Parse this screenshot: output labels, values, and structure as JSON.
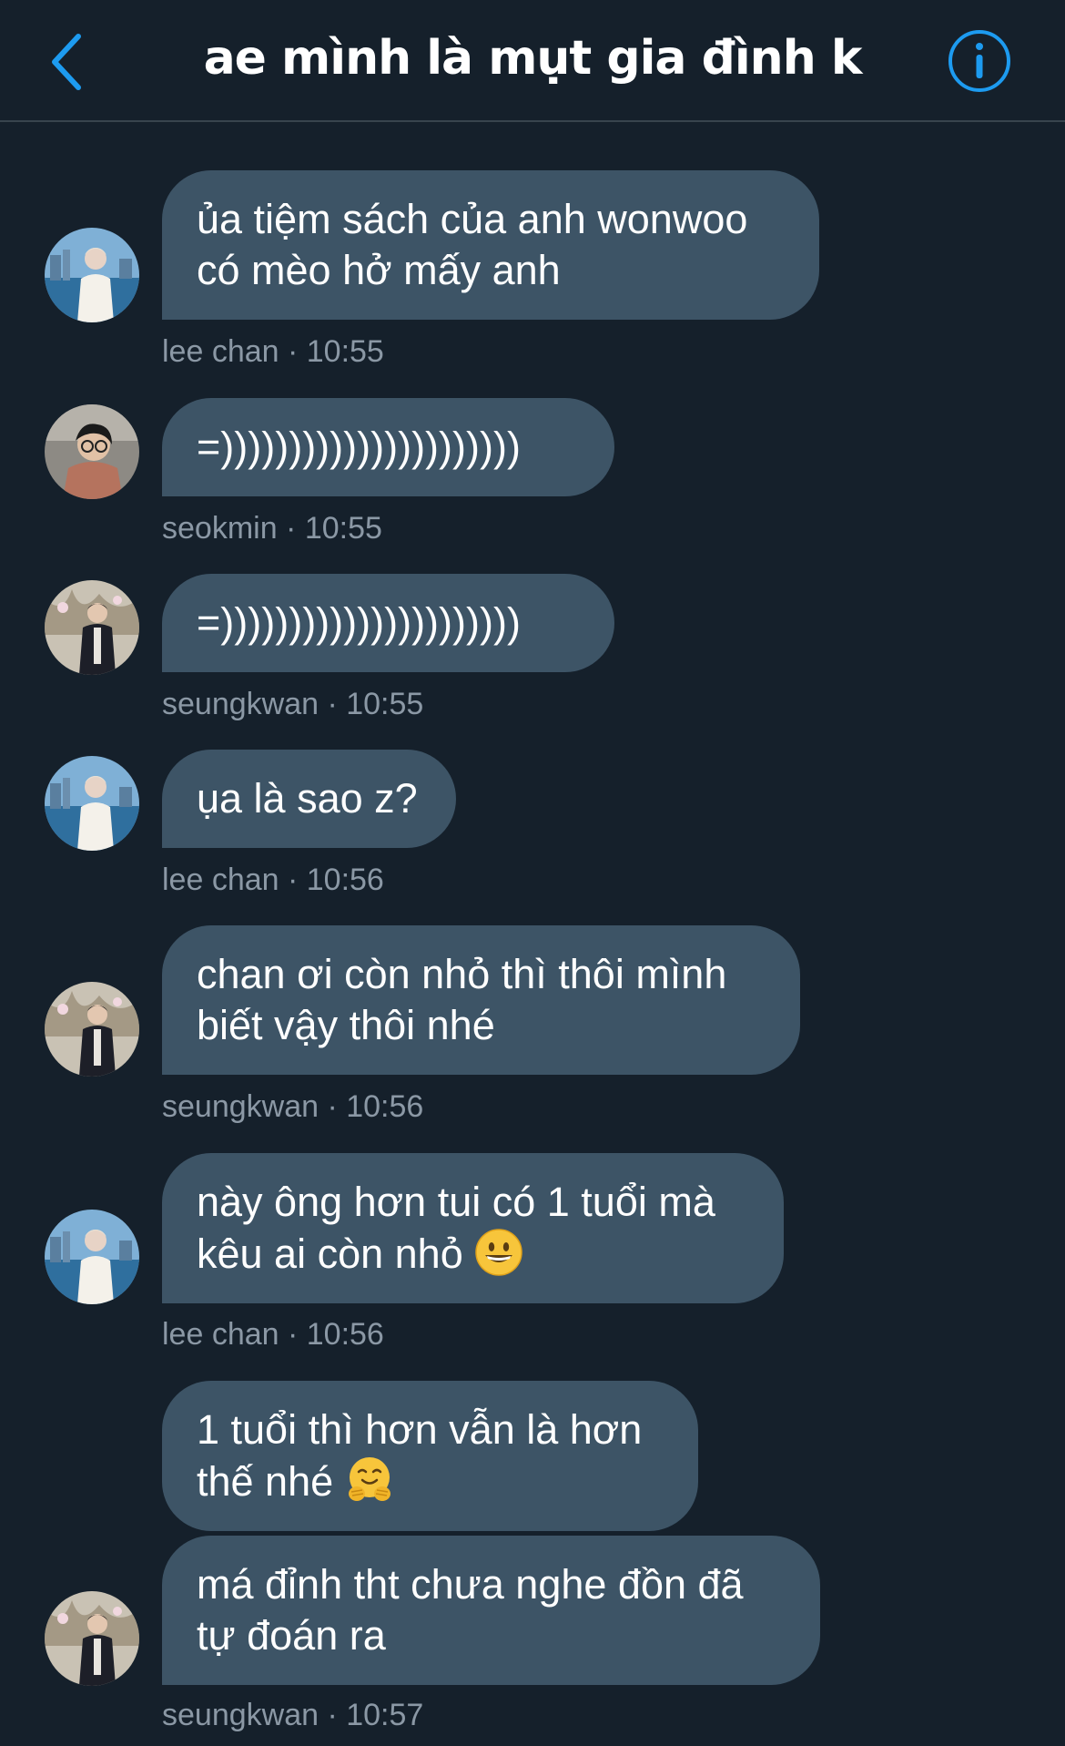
{
  "header": {
    "title": "ae mình là mụt gia đình k"
  },
  "messages": [
    {
      "lines": [
        "ủa tiệm sách của anh wonwoo",
        "có mèo hở mấy anh"
      ],
      "meta": "lee chan · 10:55",
      "avatar": "lee-chan-avatar"
    },
    {
      "lines": [
        "=))))))))))))))))))))))"
      ],
      "meta": "seokmin · 10:55",
      "avatar": "seokmin-avatar"
    },
    {
      "lines": [
        "=))))))))))))))))))))))"
      ],
      "meta": "seungkwan · 10:55",
      "avatar": "seungkwan-avatar"
    },
    {
      "lines": [
        "ụa là sao z?"
      ],
      "meta": "lee chan · 10:56",
      "avatar": "lee-chan-avatar"
    },
    {
      "lines": [
        "chan ơi còn nhỏ thì thôi mình",
        "biết vậy thôi nhé"
      ],
      "meta": "seungkwan · 10:56",
      "avatar": "seungkwan-avatar"
    },
    {
      "lines": [
        "này ông hơn tui có 1 tuổi mà",
        "kêu ai còn nhỏ"
      ],
      "emoji": "grinning-face-emoji",
      "meta": "lee chan · 10:56",
      "avatar": "lee-chan-avatar"
    },
    {
      "lines": [
        "1 tuổi thì hơn vẫn là hơn",
        "thế nhé"
      ],
      "emoji": "hugging-face-emoji"
    },
    {
      "lines": [
        "má đỉnh tht chưa nghe đồn đã",
        "tự đoán ra"
      ],
      "meta": "seungkwan · 10:57",
      "avatar": "seungkwan-avatar"
    }
  ],
  "colors": {
    "background": "#15202b",
    "bubble": "#3d5466",
    "meta_text": "#8b98a5",
    "accent": "#1d9bf0"
  }
}
